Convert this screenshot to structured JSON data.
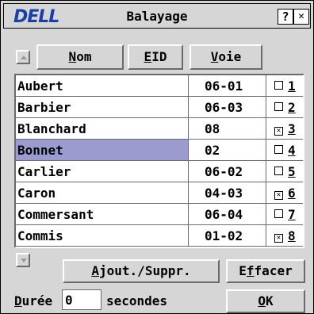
{
  "window": {
    "logo": "DELL",
    "title": "Balayage",
    "help_label": "?",
    "close_label": "✕"
  },
  "header": {
    "nom_mnemonic": "N",
    "nom_rest": "om",
    "eid_mnemonic": "E",
    "eid_rest": "ID",
    "voie_mnemonic": "V",
    "voie_rest": "oie"
  },
  "rows": [
    {
      "name": "Aubert",
      "eid": "06-01",
      "port": "1",
      "checked": false,
      "selected": false
    },
    {
      "name": "Barbier",
      "eid": "06-03",
      "port": "2",
      "checked": false,
      "selected": false
    },
    {
      "name": "Blanchard",
      "eid": "08",
      "port": "3",
      "checked": true,
      "selected": false
    },
    {
      "name": "Bonnet",
      "eid": "02",
      "port": "4",
      "checked": false,
      "selected": true
    },
    {
      "name": "Carlier",
      "eid": "06-02",
      "port": "5",
      "checked": false,
      "selected": false
    },
    {
      "name": "Caron",
      "eid": "04-03",
      "port": "6",
      "checked": true,
      "selected": false
    },
    {
      "name": "Commersant",
      "eid": "06-04",
      "port": "7",
      "checked": false,
      "selected": false
    },
    {
      "name": "Commis",
      "eid": "01-02",
      "port": "8",
      "checked": true,
      "selected": false
    }
  ],
  "footer": {
    "add_remove_mnemonic": "A",
    "add_remove_rest": "jout./Suppr.",
    "clear_prefix": "E",
    "clear_mnemonic": "f",
    "clear_rest": "facer",
    "duration_mnemonic": "D",
    "duration_rest": "urée",
    "duration_value": "0",
    "seconds_label": "secondes",
    "ok_mnemonic": "O",
    "ok_rest": "K"
  }
}
